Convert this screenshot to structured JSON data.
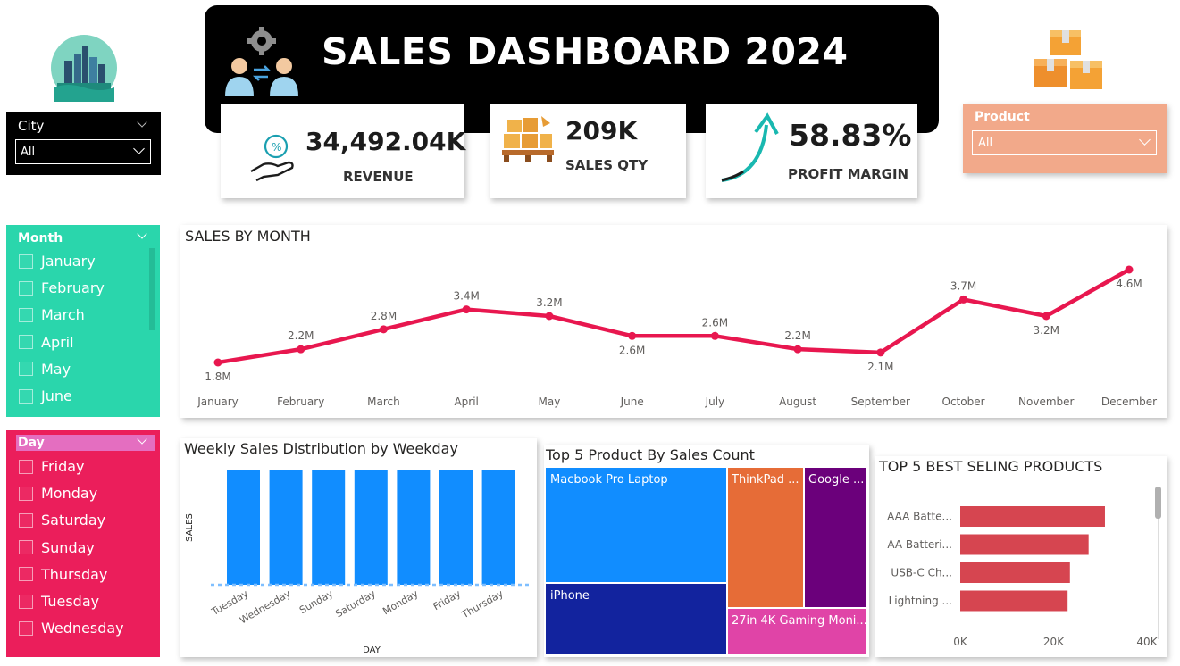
{
  "header": {
    "title": "SALES DASHBOARD 2024"
  },
  "kpis": {
    "revenue": {
      "value": "34,492.04K",
      "label": "REVENUE"
    },
    "sales_qty": {
      "value": "209K",
      "label": "SALES QTY"
    },
    "profit_margin": {
      "value": "58.83%",
      "label": "PROFIT MARGIN"
    }
  },
  "city_slicer": {
    "title": "City",
    "selected": "All"
  },
  "product_slicer": {
    "title": "Product",
    "selected": "All"
  },
  "month_slicer": {
    "title": "Month",
    "items": [
      "January",
      "February",
      "March",
      "April",
      "May",
      "June"
    ]
  },
  "day_slicer": {
    "title": "Day",
    "items": [
      "Friday",
      "Monday",
      "Saturday",
      "Sunday",
      "Thursday",
      "Tuesday",
      "Wednesday"
    ]
  },
  "colors": {
    "month_slicer_bg": "#2ad6ac",
    "day_slicer_bg": "#eb1e5b",
    "product_slicer_bg": "#f2a98a",
    "line_color": "#e8174f",
    "weekday_bar": "#118dff",
    "best_selling_bar": "#d64550",
    "treemap_macbook": "#118dff",
    "treemap_iphone": "#12239e",
    "treemap_thinkpad": "#e66c37",
    "treemap_google": "#6b007b",
    "treemap_monitor": "#e044a7"
  },
  "chart_data": [
    {
      "type": "line",
      "title": "SALES BY MONTH",
      "categories": [
        "January",
        "February",
        "March",
        "April",
        "May",
        "June",
        "July",
        "August",
        "September",
        "October",
        "November",
        "December"
      ],
      "values": [
        1.8,
        2.2,
        2.8,
        3.4,
        3.2,
        2.6,
        2.6,
        2.2,
        2.1,
        3.7,
        3.2,
        4.6
      ],
      "data_labels": [
        "1.8M",
        "2.2M",
        "2.8M",
        "3.4M",
        "3.2M",
        "2.6M",
        "2.6M",
        "2.2M",
        "2.1M",
        "3.7M",
        "3.2M",
        "4.6M"
      ],
      "unit": "M"
    },
    {
      "type": "bar",
      "title": "Weekly Sales Distribution by Weekday",
      "categories": [
        "Tuesday",
        "Wednesday",
        "Sunday",
        "Saturday",
        "Monday",
        "Friday",
        "Thursday"
      ],
      "values": [
        1,
        1,
        1,
        1,
        1,
        1,
        1
      ],
      "xlabel": "DAY",
      "ylabel": "SALES"
    },
    {
      "type": "treemap",
      "title": "Top 5 Product By Sales Count",
      "items": [
        {
          "label": "Macbook Pro Laptop"
        },
        {
          "label": "iPhone"
        },
        {
          "label": "ThinkPad ..."
        },
        {
          "label": "Google ..."
        },
        {
          "label": "27in 4K Gaming Moni..."
        }
      ]
    },
    {
      "type": "bar",
      "orientation": "horizontal",
      "title": "TOP 5 BEST SELING PRODUCTS",
      "categories": [
        "AAA Batte...",
        "AA Batteri...",
        "USB-C Ch...",
        "Lightning ..."
      ],
      "values": [
        31000,
        27500,
        23500,
        23000
      ],
      "xlim": [
        0,
        40000
      ],
      "xticks": [
        "0K",
        "20K",
        "40K"
      ]
    }
  ]
}
